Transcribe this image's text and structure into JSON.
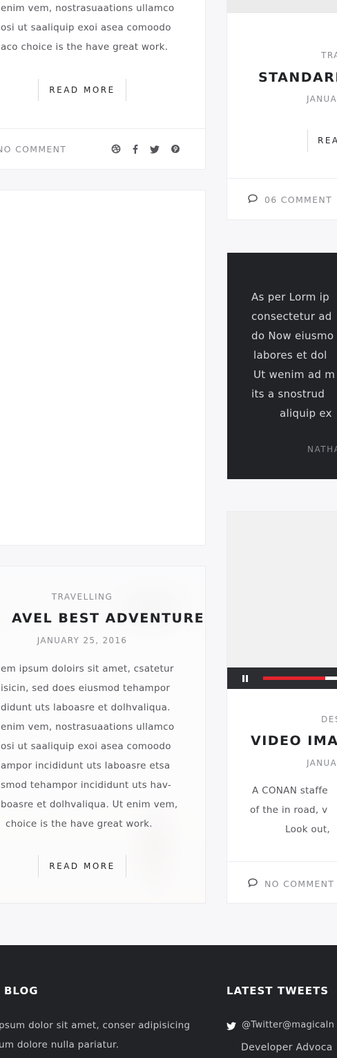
{
  "post_top_left": {
    "lines": [
      "enim  vem, nostrasuaations ullamco",
      "osi ut saaliquip exoi asea comoodo",
      "aco choice is the have great work."
    ],
    "read_more": "READ MORE",
    "comment": "NO COMMENT",
    "social_icons": [
      "dribbble-icon",
      "facebook-icon",
      "twitter-icon",
      "pinterest-icon"
    ]
  },
  "post_standard": {
    "category": "TRA",
    "title": "STANDARD",
    "date": "JANUA",
    "read_more": "REA",
    "comment": "06 COMMENT"
  },
  "post_travel": {
    "category": "TRAVELLING",
    "title": "AVEL BEST ADVENTURE",
    "date": "JANUARY 25, 2016",
    "lines": [
      "em ipsum doloirs sit amet, csatetur",
      "isicin, sed does eiusmod tehampor",
      "didunt uts laboasre et dolhvaliqua.",
      "enim  vem, nostrasuaations ullamco",
      "osi ut saaliquip exoi asea comoodo",
      "ampor incididunt uts laboasre etsa",
      "smod tehampor incididunt uts hav-",
      "boasre et dolhvaliqua. Ut enim  vem,",
      "choice is the have great work."
    ],
    "read_more": "READ MORE"
  },
  "quote": {
    "lines": [
      "As per Lorm ip",
      "consectetur ad",
      "do Now eiusmo",
      "labores et dol",
      "Ut wenim ad m",
      "its a snostrud",
      "aliquip ex"
    ],
    "author": "NATHA"
  },
  "post_video": {
    "progress": 0.64,
    "category": "DES",
    "title": "VIDEO IMAG",
    "date": "JANUA",
    "lines": [
      "A CONAN staffe",
      "of the in  road, v",
      "Look out,"
    ],
    "comment": "NO COMMENT"
  },
  "footer": {
    "blog_heading": "BLOG",
    "blog_lines": [
      "psum dolor sit amet, conser adipisicing",
      "um dolore nulla pariatur."
    ],
    "tweets_heading": "LATEST TWEETS",
    "tweet_handle": "@Twitter@magicaln",
    "tweet_text": "Developer Advoca"
  },
  "colors": {
    "accent": "#e6242d",
    "dark": "#222327",
    "background": "#f7f7f9"
  }
}
